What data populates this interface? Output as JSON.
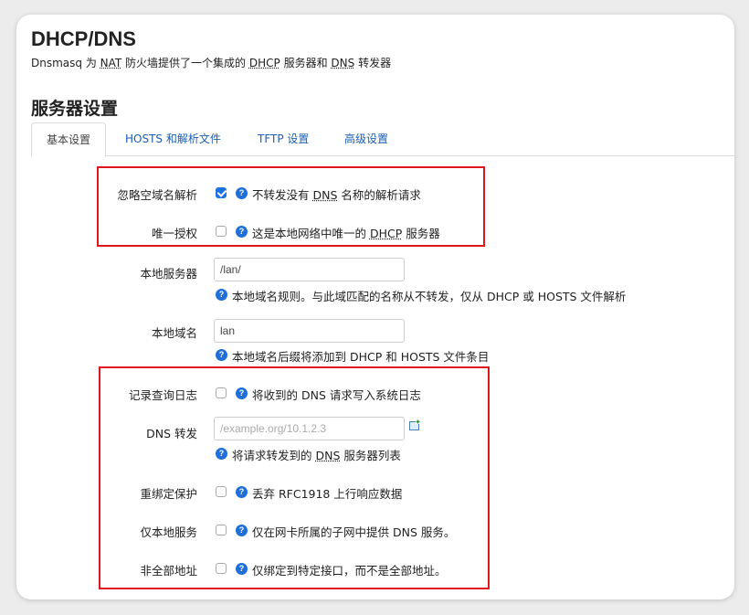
{
  "header": {
    "title": "DHCP/DNS",
    "desc_prefix": "Dnsmasq 为 ",
    "desc_nat": "NAT",
    "desc_mid1": " 防火墙提供了一个集成的 ",
    "desc_dhcp": "DHCP",
    "desc_mid2": " 服务器和 ",
    "desc_dns": "DNS",
    "desc_suffix": " 转发器"
  },
  "section": {
    "title": "服务器设置"
  },
  "tabs": [
    "基本设置",
    "HOSTS 和解析文件",
    "TFTP 设置",
    "高级设置"
  ],
  "fields": {
    "domain_needed": {
      "label": "忽略空域名解析",
      "checked": true,
      "text_a": "不转发没有 ",
      "abbr": "DNS",
      "text_b": " 名称的解析请求"
    },
    "authoritative": {
      "label": "唯一授权",
      "checked": false,
      "text_a": "这是本地网络中唯一的 ",
      "abbr": "DHCP",
      "text_b": " 服务器"
    },
    "local": {
      "label": "本地服务器",
      "value": "/lan/",
      "help": "本地域名规则。与此域匹配的名称从不转发，仅从 DHCP 或 HOSTS 文件解析"
    },
    "domain": {
      "label": "本地域名",
      "value": "lan",
      "help": "本地域名后缀将添加到 DHCP 和 HOSTS 文件条目"
    },
    "logqueries": {
      "label": "记录查询日志",
      "checked": false,
      "text": "将收到的 DNS 请求写入系统日志"
    },
    "server": {
      "label": "DNS 转发",
      "placeholder": "/example.org/10.1.2.3",
      "help_a": "将请求转发到的 ",
      "abbr": "DNS",
      "help_b": " 服务器列表"
    },
    "rebind_protection": {
      "label": "重绑定保护",
      "checked": false,
      "text": "丢弃 RFC1918 上行响应数据"
    },
    "localservice": {
      "label": "仅本地服务",
      "checked": false,
      "text": "仅在网卡所属的子网中提供 DNS 服务。"
    },
    "nonwildcard": {
      "label": "非全部地址",
      "checked": false,
      "text": "仅绑定到特定接口，而不是全部地址。"
    }
  },
  "help_icon_glyph": "?",
  "colors": {
    "accent": "#1e72e8",
    "link": "#1a5fb4",
    "highlight": "#e0161e"
  }
}
